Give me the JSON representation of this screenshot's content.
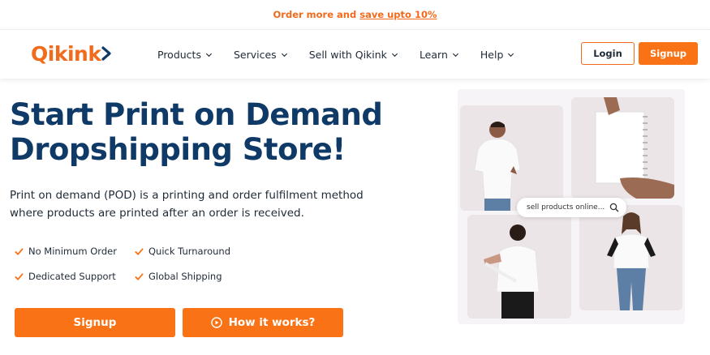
{
  "promo": {
    "text": "Order more and",
    "link": "save upto 10%"
  },
  "header": {
    "logo_text": "Qikink",
    "menu": [
      {
        "label": "Products"
      },
      {
        "label": "Services"
      },
      {
        "label": "Sell with Qikink"
      },
      {
        "label": "Learn"
      },
      {
        "label": "Help"
      }
    ],
    "login_label": "Login",
    "signup_label": "Signup"
  },
  "hero": {
    "title_line1": "Start Print on Demand",
    "title_line2": "Dropshipping Store!",
    "description": "Print on demand (POD) is a printing and order fulfilment method where products are printed after an order is received.",
    "features": [
      "No Minimum Order",
      "Quick Turnaround",
      "Dedicated Support",
      "Global Shipping"
    ],
    "signup_label": "Signup",
    "how_label": "How it works?"
  },
  "collage": {
    "search_text": "sell products online..."
  },
  "colors": {
    "accent": "#f97316",
    "heading": "#0f3a67"
  }
}
